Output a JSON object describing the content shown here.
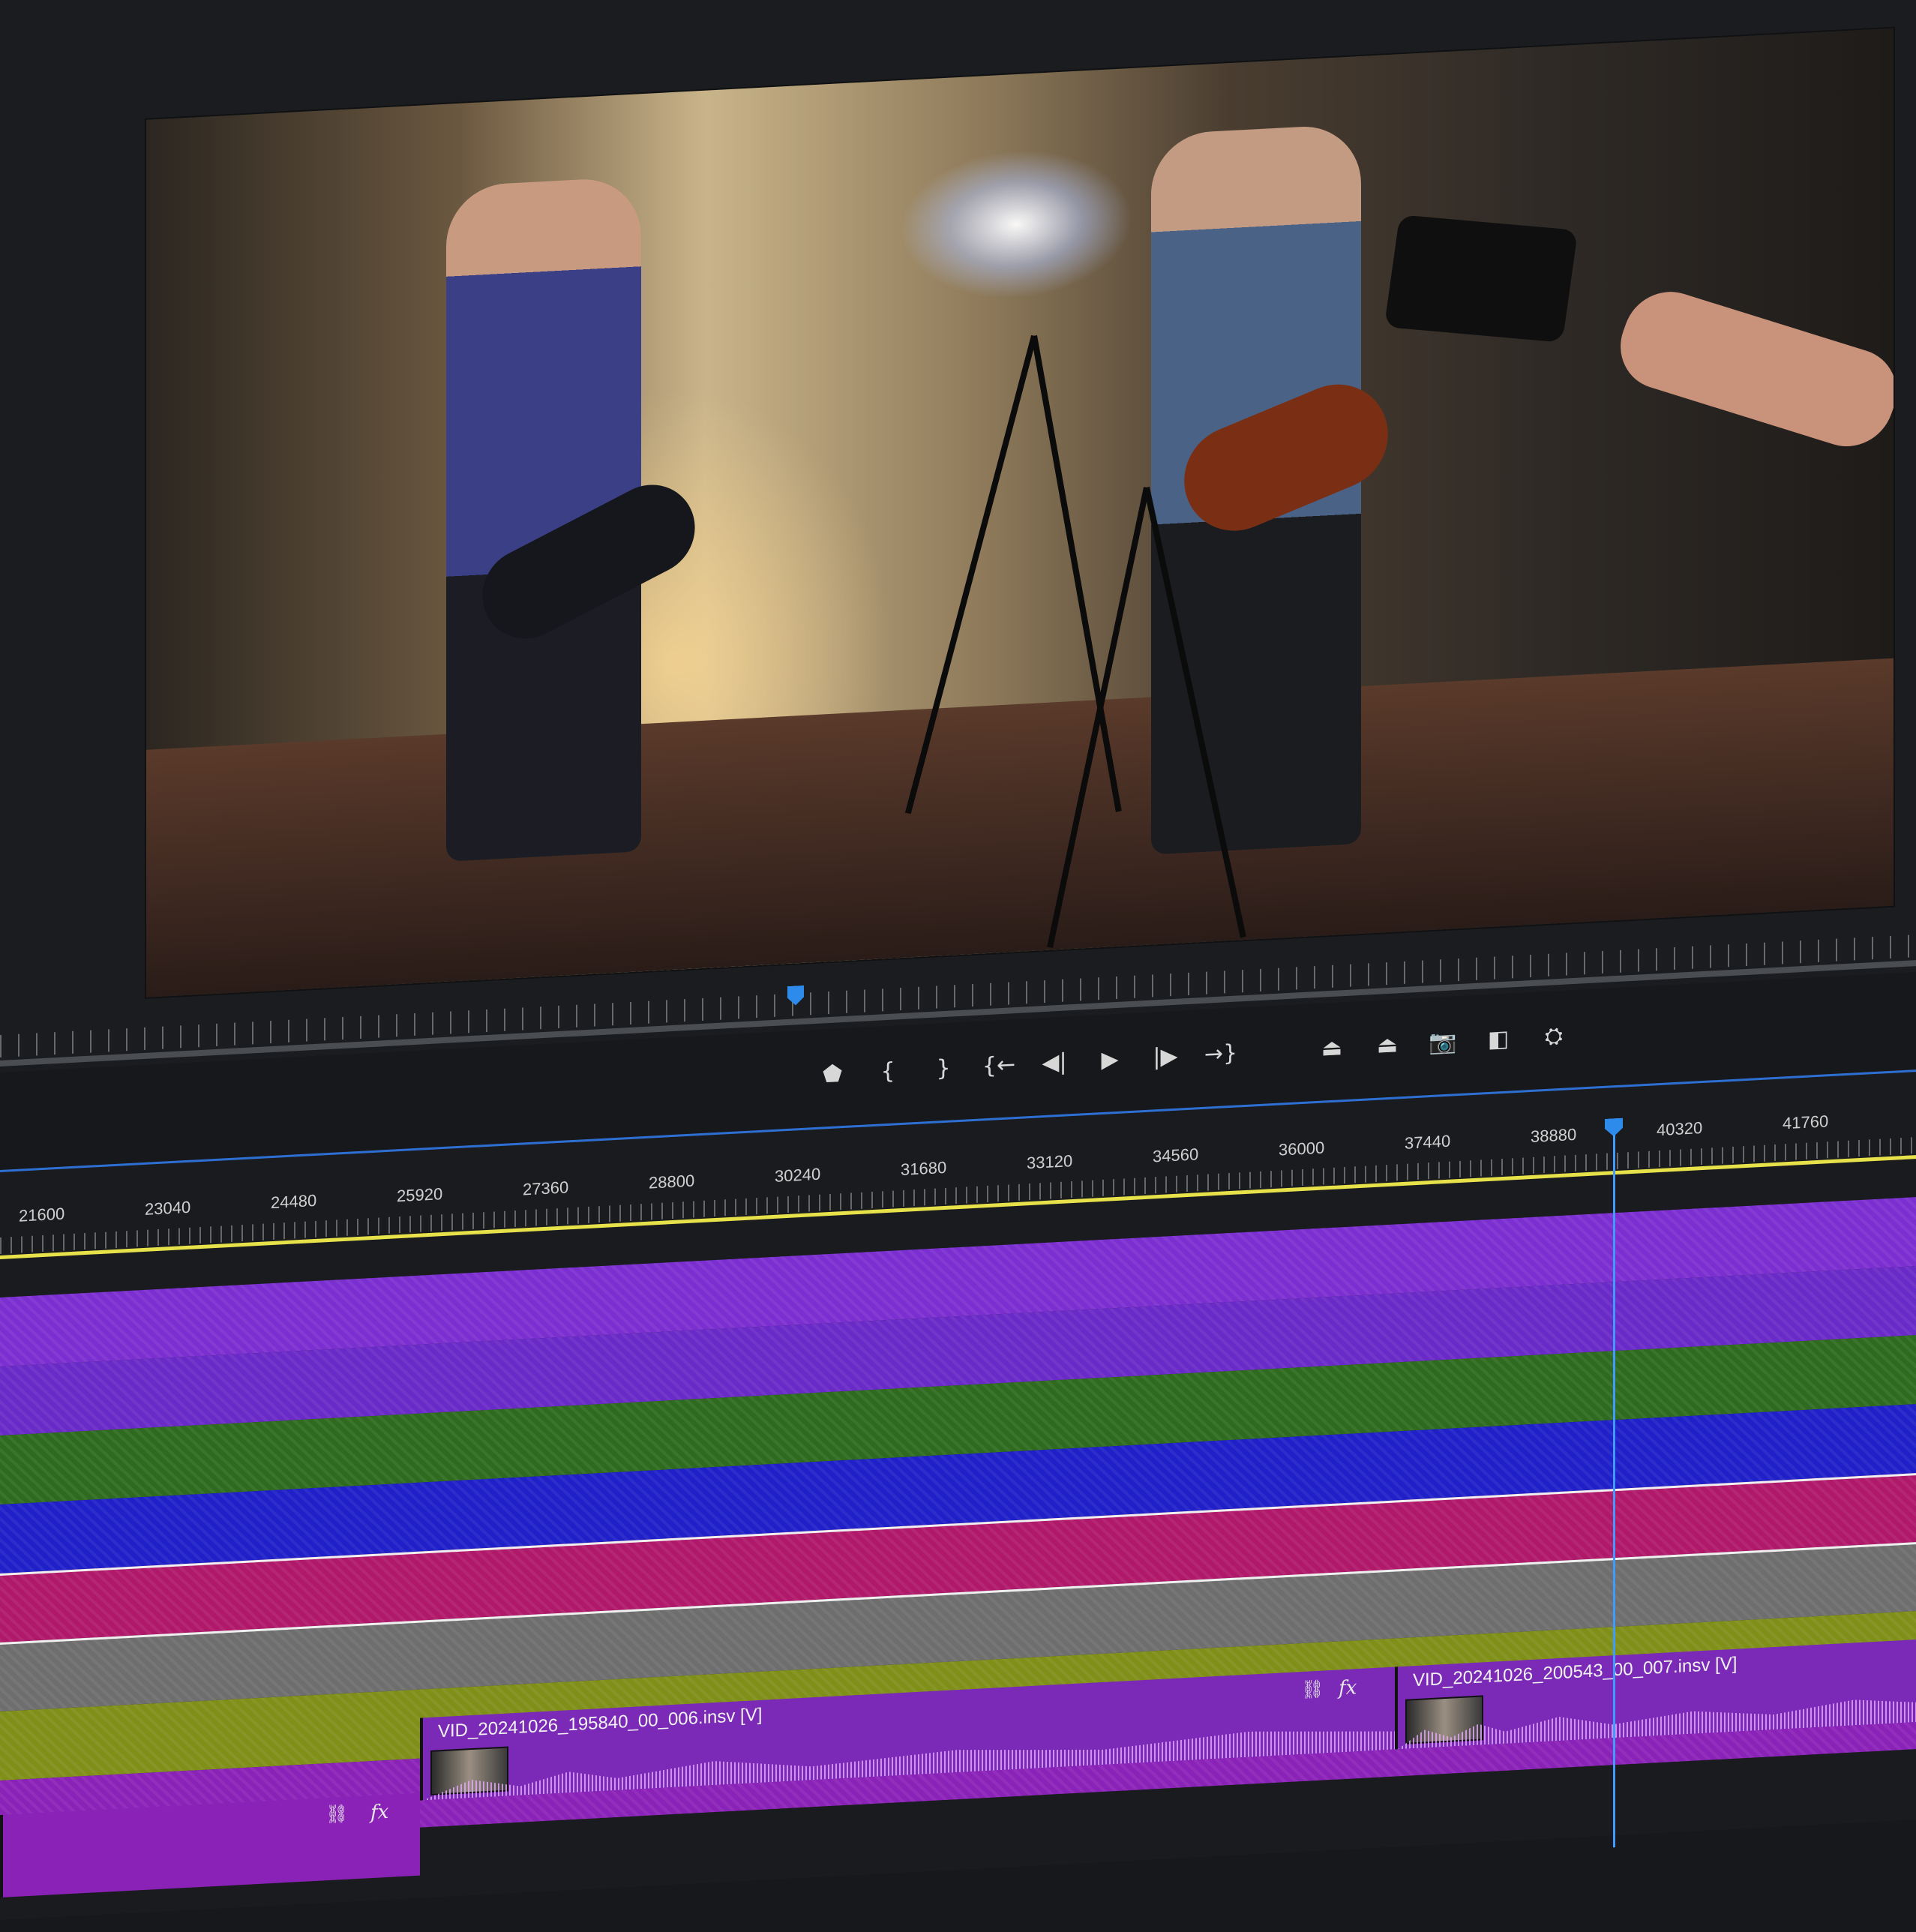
{
  "monitor": {
    "transport": [
      {
        "name": "add-marker-button",
        "glyph": "⬟"
      },
      {
        "name": "mark-in-button",
        "glyph": "{"
      },
      {
        "name": "mark-out-button",
        "glyph": "}"
      },
      {
        "name": "go-to-in-button",
        "glyph": "{←"
      },
      {
        "name": "step-back-button",
        "glyph": "◀|"
      },
      {
        "name": "play-button",
        "glyph": "▶"
      },
      {
        "name": "step-forward-button",
        "glyph": "|▶"
      },
      {
        "name": "go-to-out-button",
        "glyph": "→}"
      },
      {
        "name": "lift-button",
        "glyph": "⏏"
      },
      {
        "name": "extract-button",
        "glyph": "⏏"
      },
      {
        "name": "export-frame-button",
        "glyph": "📷"
      },
      {
        "name": "comparison-view-button",
        "glyph": "◧"
      },
      {
        "name": "vr-video-button",
        "glyph": "⛭"
      }
    ]
  },
  "timeline": {
    "ruler_labels": [
      "21600",
      "23040",
      "24480",
      "25920",
      "27360",
      "28800",
      "30240",
      "31680",
      "33120",
      "34560",
      "36000",
      "37440",
      "38880",
      "40320",
      "41760"
    ],
    "track_colors": [
      "#7b2fd1",
      "#6a2ac8",
      "#2f6b1f",
      "#2020c8",
      "#b0186a",
      "#6e6e6e",
      "#7f8f18",
      "#8a22b8"
    ],
    "clips": [
      {
        "name": "VID_20241026_195840_00_006.insv [V]"
      },
      {
        "name": "VID_20241026_200543_00_007.insv [V]"
      }
    ],
    "fx_label": "fx",
    "link_glyph": "⛓"
  }
}
